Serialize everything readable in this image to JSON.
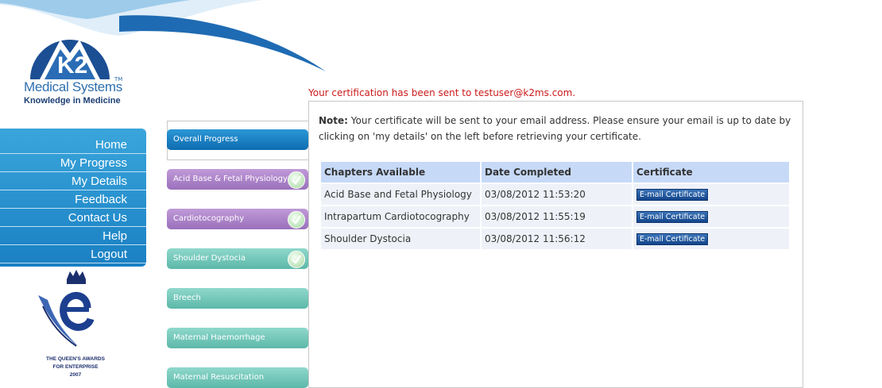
{
  "logo": {
    "brand": "K2",
    "name": "Medical Systems",
    "tm": "TM",
    "tagline": "Knowledge in Medicine"
  },
  "nav": {
    "items": [
      "Home",
      "My Progress",
      "My Details",
      "Feedback",
      "Contact Us",
      "Help",
      "Logout"
    ]
  },
  "award": {
    "line1": "THE QUEEN'S AWARDS",
    "line2": "FOR ENTERPRISE",
    "line3": "2007"
  },
  "message": "Your certification has been sent to testuser@k2ms.com.",
  "tabs": [
    {
      "label": "Overall Progress",
      "state": "active",
      "completed": false
    },
    {
      "label": "Acid Base & Fetal Physiology",
      "state": "purple",
      "completed": true
    },
    {
      "label": "Cardiotocography",
      "state": "purple",
      "completed": true
    },
    {
      "label": "Shoulder Dystocia",
      "state": "teal",
      "completed": true
    },
    {
      "label": "Breech",
      "state": "teal",
      "completed": false
    },
    {
      "label": "Maternal Haemorrhage",
      "state": "teal",
      "completed": false
    },
    {
      "label": "Maternal Resuscitation",
      "state": "teal",
      "completed": false
    }
  ],
  "note": {
    "label": "Note:",
    "text": "Your certificate will be sent to your email address. Please ensure your email is up to date by clicking on 'my details' on the left before retrieving your certificate."
  },
  "table": {
    "headers": [
      "Chapters Available",
      "Date Completed",
      "Certificate"
    ],
    "rows": [
      {
        "chapter": "Acid Base and Fetal Physiology",
        "date": "03/08/2012 11:53:20",
        "button": "E-mail Certificate"
      },
      {
        "chapter": "Intrapartum Cardiotocography",
        "date": "03/08/2012 11:55:19",
        "button": "E-mail Certificate"
      },
      {
        "chapter": "Shoulder Dystocia",
        "date": "03/08/2012 11:56:12",
        "button": "E-mail Certificate"
      }
    ]
  },
  "colors": {
    "accent_blue": "#1a80c3",
    "message_red": "#cc1a1a",
    "tab_purple": "#9a70bb",
    "tab_teal": "#5cb8a9"
  }
}
